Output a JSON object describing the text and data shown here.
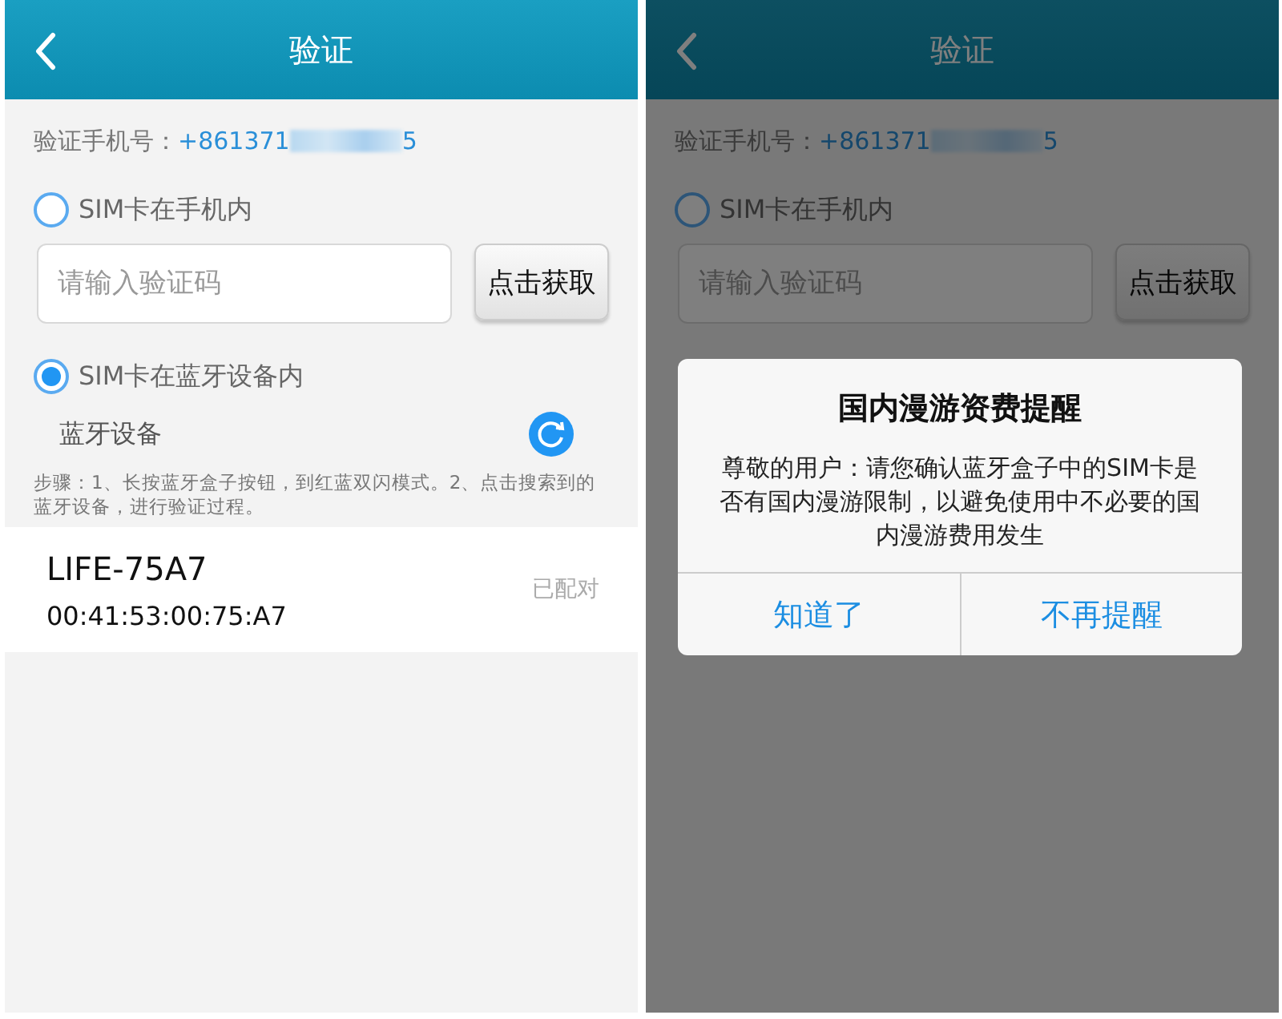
{
  "screens": [
    {
      "header": {
        "title": "验证"
      },
      "phone": {
        "label": "验证手机号：",
        "prefix": "+861371",
        "suffix": "5"
      },
      "options": [
        {
          "label": "SIM卡在手机内",
          "selected": false
        },
        {
          "label": "SIM卡在蓝牙设备内",
          "selected": true
        }
      ],
      "code_field": {
        "placeholder": "请输入验证码"
      },
      "get_code_button": "点击获取",
      "bluetooth": {
        "label": "蓝牙设备",
        "steps": "步骤：1、长按蓝牙盒子按钮，到红蓝双闪模式。2、点击搜索到的蓝牙设备，进行验证过程。"
      },
      "devices": [
        {
          "name": "LIFE-75A7",
          "address": "00:41:53:00:75:A7",
          "status": "已配对"
        }
      ]
    },
    {
      "header": {
        "title": "验证"
      },
      "phone": {
        "label": "验证手机号：",
        "prefix": "+861371",
        "suffix": "5"
      },
      "options": [
        {
          "label": "SIM卡在手机内",
          "selected": false
        }
      ],
      "code_field": {
        "placeholder": "请输入验证码"
      },
      "get_code_button": "点击获取",
      "dialog": {
        "title": "国内漫游资费提醒",
        "message": "尊敬的用户：请您确认蓝牙盒子中的SIM卡是否有国内漫游限制，以避免使用中不必要的国内漫游费用发生",
        "buttons": [
          "知道了",
          "不再提醒"
        ]
      }
    }
  ]
}
